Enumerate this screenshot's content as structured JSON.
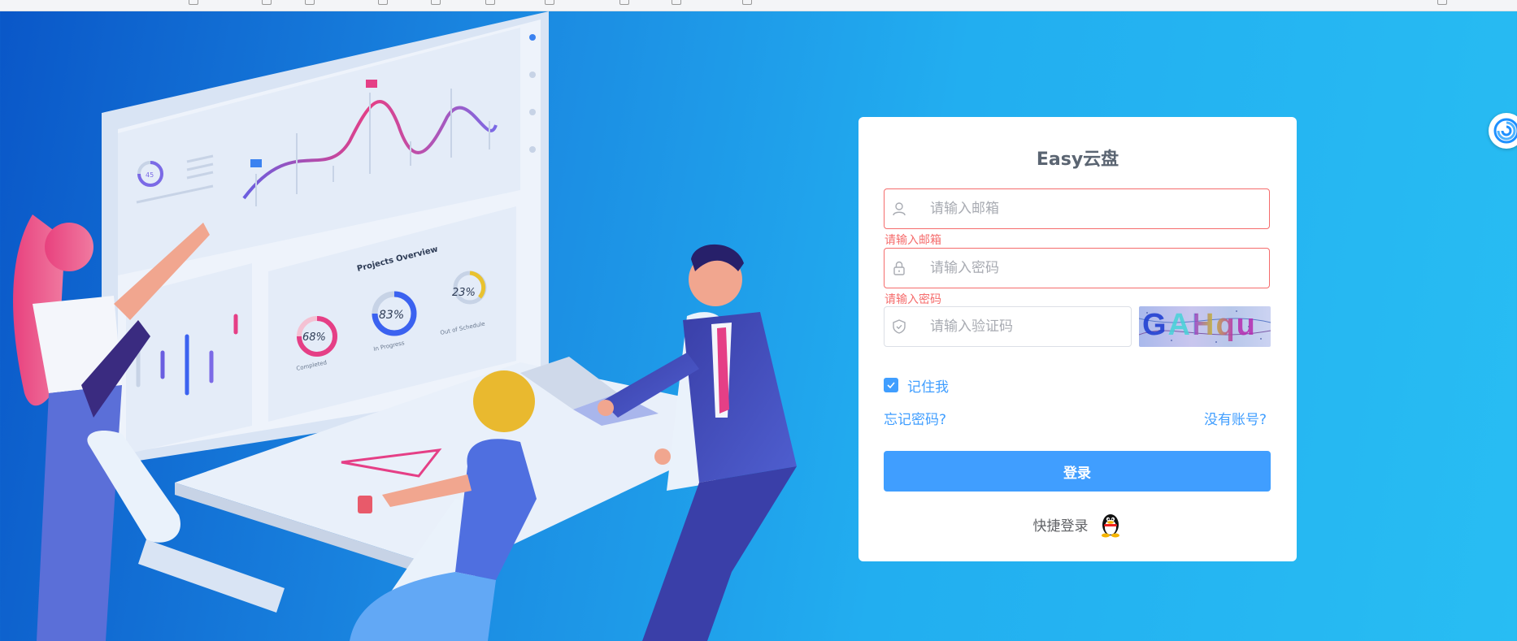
{
  "app": {
    "title": "Easy云盘"
  },
  "form": {
    "email": {
      "placeholder": "请输入邮箱",
      "value": "",
      "error": "请输入邮箱"
    },
    "password": {
      "placeholder": "请输入密码",
      "value": "",
      "error": "请输入密码"
    },
    "captcha": {
      "placeholder": "请输入验证码",
      "value": "",
      "image_text": "GAHqu"
    },
    "remember_label": "记住我",
    "remember_checked": true,
    "forgot_label": "忘记密码?",
    "register_label": "没有账号?",
    "login_label": "登录",
    "quick_login_label": "快捷登录"
  },
  "illustration": {
    "overview_title": "Projects Overview",
    "gauges": [
      {
        "value": "68%",
        "label": "Completed"
      },
      {
        "value": "83%",
        "label": "In Progress"
      },
      {
        "value": "23%",
        "label": "Out of Schedule"
      }
    ],
    "small_gauge": "45"
  },
  "icons": [
    "user-icon",
    "lock-icon",
    "shield-icon",
    "check-icon",
    "qq-penguin-icon",
    "assistant-swirl-icon"
  ],
  "colors": {
    "primary": "#409eff",
    "error": "#f56c6c",
    "title": "#5b6572",
    "bg_start": "#0a57c8",
    "bg_end": "#28bdf3"
  }
}
